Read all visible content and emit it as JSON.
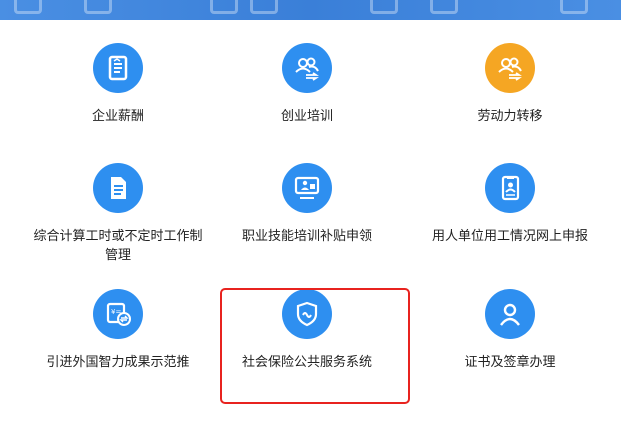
{
  "colors": {
    "primary": "#2e8ff0",
    "accent": "#f5a623",
    "highlight": "#e8231f"
  },
  "services": [
    {
      "label": "企业薪酬",
      "icon": "salary-document-icon",
      "color": "blue"
    },
    {
      "label": "创业培训",
      "icon": "people-group-arrows-icon",
      "color": "blue"
    },
    {
      "label": "劳动力转移",
      "icon": "people-group-arrows-icon",
      "color": "orange"
    },
    {
      "label": "综合计算工时或不定时工作制管理",
      "icon": "document-list-icon",
      "color": "blue"
    },
    {
      "label": "职业技能培训补贴申领",
      "icon": "training-screen-icon",
      "color": "blue"
    },
    {
      "label": "用人单位用工情况网上申报",
      "icon": "id-card-icon",
      "color": "blue"
    },
    {
      "label": "引进外国智力成果示范推",
      "icon": "exchange-calculator-icon",
      "color": "blue"
    },
    {
      "label": "社会保险公共服务系统",
      "icon": "shield-icon",
      "color": "blue",
      "highlighted": true
    },
    {
      "label": "证书及签章办理",
      "icon": "person-icon",
      "color": "blue"
    }
  ]
}
